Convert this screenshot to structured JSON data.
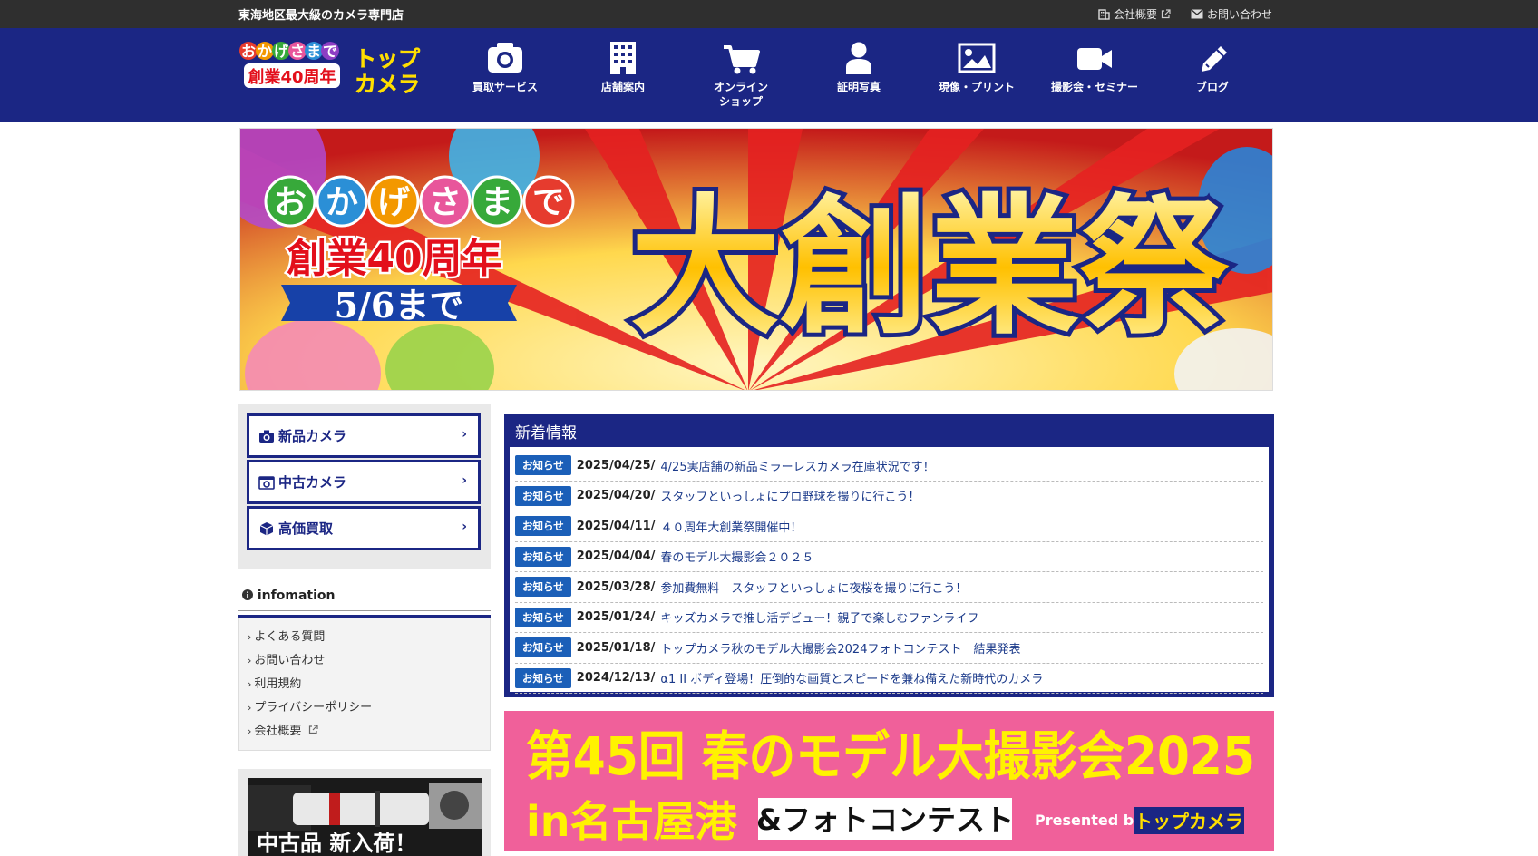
{
  "topbar": {
    "tagline": "東海地区最大級のカメラ専門店",
    "links": [
      {
        "label": "会社概要",
        "icon": "building-icon",
        "external": true
      },
      {
        "label": "お問い合わせ",
        "icon": "mail-icon",
        "external": false
      }
    ]
  },
  "logo": {
    "line1": "おかげさまで",
    "line2": "創業40周年",
    "brand_top": "トップ",
    "brand_bottom": "カメラ"
  },
  "nav": [
    {
      "label": "買取サービス",
      "icon": "camera-icon"
    },
    {
      "label": "店舗案内",
      "icon": "building-icon"
    },
    {
      "label": "オンライン",
      "label2": "ショップ",
      "icon": "cart-icon"
    },
    {
      "label": "証明写真",
      "icon": "person-icon"
    },
    {
      "label": "現像・プリント",
      "icon": "picture-icon"
    },
    {
      "label": "撮影会・セミナー",
      "icon": "video-camera-icon"
    },
    {
      "label": "ブログ",
      "icon": "pencil-icon"
    }
  ],
  "hero": {
    "bubbles": [
      "お",
      "か",
      "げ",
      "さ",
      "ま",
      "で"
    ],
    "anniv": "創業40周年",
    "until": "5/6まで",
    "big": "大創業祭"
  },
  "sidebar": {
    "buttons": [
      {
        "label": "新品カメラ",
        "icon": "camera-icon"
      },
      {
        "label": "中古カメラ",
        "icon": "used-camera-icon"
      },
      {
        "label": "高価買取",
        "icon": "box-icon"
      }
    ],
    "info_title": "infomation",
    "info_links": [
      "よくある質問",
      "お問い合わせ",
      "利用規約",
      "プライバシーポリシー",
      "会社概要"
    ],
    "promo_text": "中古品 新入荷！"
  },
  "news": {
    "title": "新着情報",
    "tag": "お知らせ",
    "items": [
      {
        "date": "2025/04/25/",
        "title": "4/25実店舗の新品ミラーレスカメラ在庫状況です！"
      },
      {
        "date": "2025/04/20/",
        "title": "スタッフといっしょにプロ野球を撮りに行こう！"
      },
      {
        "date": "2025/04/11/",
        "title": "４０周年大創業祭開催中！"
      },
      {
        "date": "2025/04/04/",
        "title": "春のモデル大撮影会２０２５"
      },
      {
        "date": "2025/03/28/",
        "title": "参加費無料　スタッフといっしょに夜桜を撮りに行こう！"
      },
      {
        "date": "2025/01/24/",
        "title": "キッズカメラで推し活デビュー！親子で楽しむファンライフ"
      },
      {
        "date": "2025/01/18/",
        "title": "トップカメラ秋のモデル大撮影会2024フォトコンテスト　結果発表"
      },
      {
        "date": "2024/12/13/",
        "title": "α1 II ボディ登場！圧倒的な画質とスピードを兼ね備えた新時代のカメラ"
      }
    ]
  },
  "promo": {
    "line1": "第45回 春のモデル大撮影会2025",
    "line2": "in名古屋港",
    "contest": "&フォトコンテスト",
    "presented": "Presented by",
    "brand": "トップカメラ"
  },
  "colors": {
    "navy": "#1b2684",
    "topbar": "#2f2f2f",
    "tag_blue": "#1b5fb8",
    "promo_pink": "#f0609a",
    "promo_yellow": "#fff200"
  }
}
